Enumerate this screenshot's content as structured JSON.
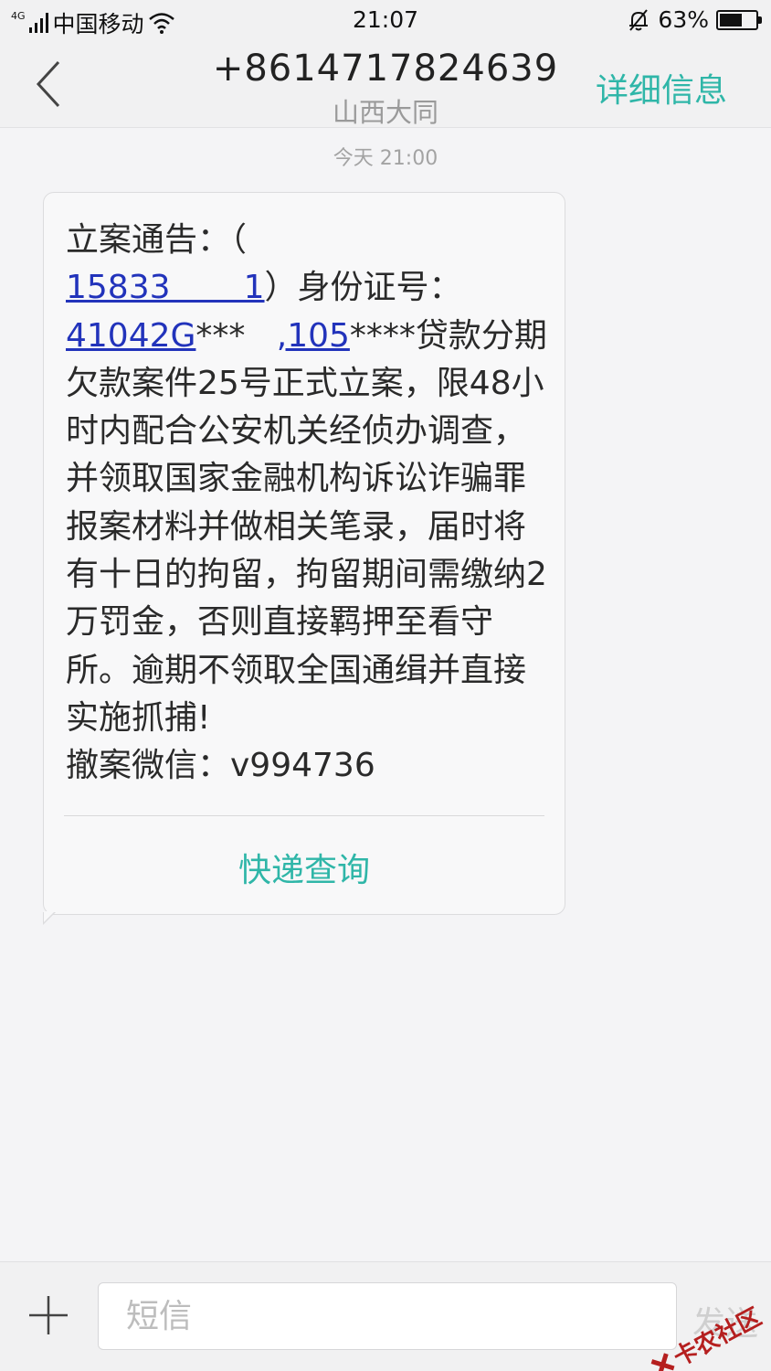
{
  "status_bar": {
    "network": "4G",
    "carrier": "中国移动",
    "time": "21:07",
    "battery": "63%",
    "battery_level": 0.63,
    "icons": [
      "signal-icon",
      "wifi-icon",
      "bell-muted-icon",
      "battery-icon"
    ]
  },
  "header": {
    "back_icon": "chevron-left-icon",
    "phone_number": "+8614717824639",
    "location": "山西大同",
    "details_label": "详细信息"
  },
  "thread": {
    "timestamp": "今天 21:00",
    "message": {
      "text_1": "立案通告：（",
      "text_2": "\n",
      "link_phone": "15833       1",
      "text_3": "）身份证号：\n",
      "link_id_1": "41042G",
      "text_4": "***   ",
      "link_id_2": ",105",
      "text_5": "****贷款分期欠款案件25号正式立案，限48小时内配合公安机关经侦办调查，并领取国家金融机构诉讼诈骗罪报案材料并做相关笔录，届时将有十日的拘留，拘留期间需缴纳2万罚金，否则直接羁押至看守所。逾期不领取全国通缉并直接实施抓捕!\n撤案微信：v994736",
      "action_label": "快递查询"
    }
  },
  "composer": {
    "plus_icon": "plus-icon",
    "placeholder": "短信",
    "send_label": "发送"
  },
  "watermark": {
    "text": "卡农社区"
  },
  "colors": {
    "accent": "#2fb6a8",
    "link": "#2233bb",
    "background": "#f4f4f6"
  }
}
